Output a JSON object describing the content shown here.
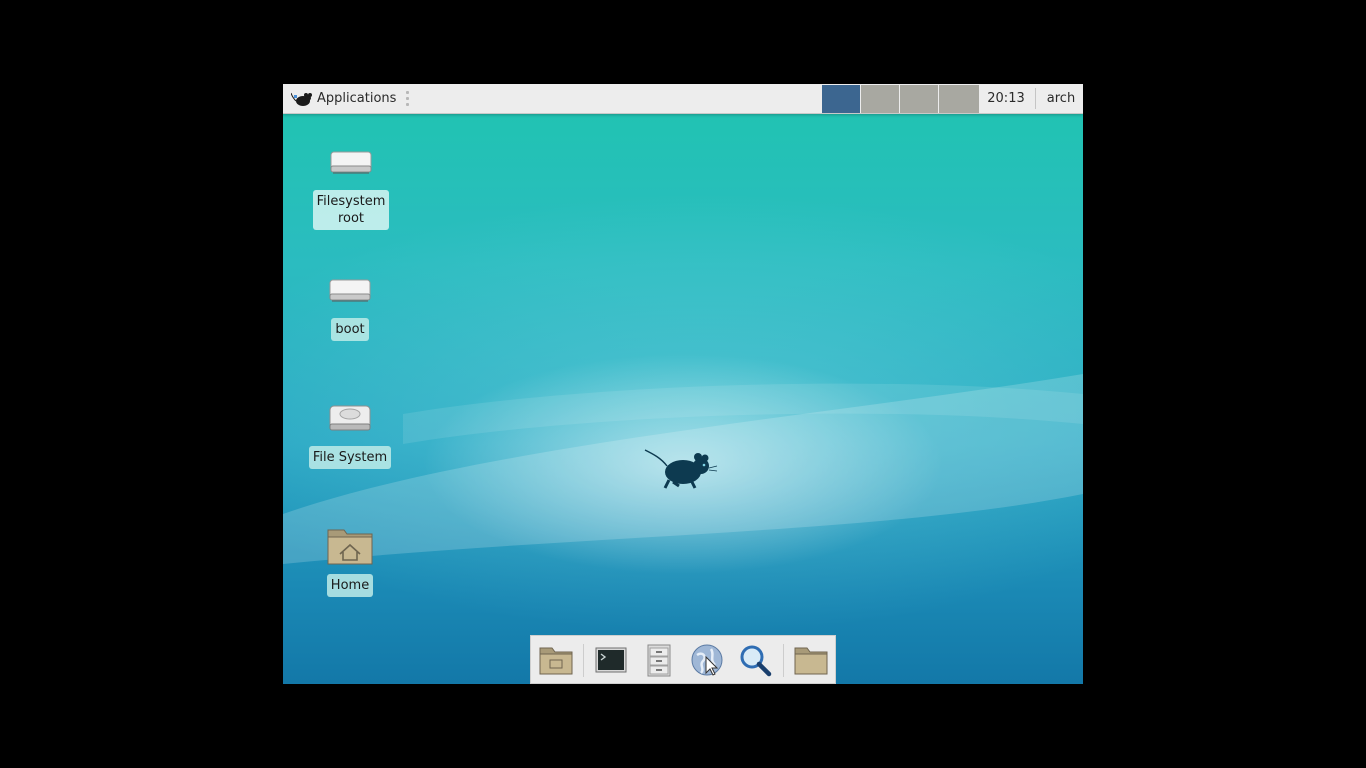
{
  "panel": {
    "menu_label": "Applications",
    "clock": "20:13",
    "user": "arch",
    "workspaces": [
      {
        "index": 1,
        "active": true
      },
      {
        "index": 2,
        "active": false
      },
      {
        "index": 3,
        "active": false
      },
      {
        "index": 4,
        "active": false
      }
    ],
    "colors": {
      "active_workspace": "#3c6690",
      "inactive_workspace": "#a8a8a1"
    }
  },
  "desktop": {
    "icons": [
      {
        "label": "Filesystem\nroot",
        "icon": "drive-icon"
      },
      {
        "label": "boot",
        "icon": "drive-icon"
      },
      {
        "label": "File System",
        "icon": "harddisk-icon"
      },
      {
        "label": "Home",
        "icon": "home-folder-icon"
      }
    ]
  },
  "dock": {
    "items": [
      {
        "icon": "desktop-folder-icon"
      },
      {
        "icon": "terminal-icon"
      },
      {
        "icon": "file-cabinet-icon"
      },
      {
        "icon": "web-browser-icon"
      },
      {
        "icon": "search-icon"
      },
      {
        "icon": "folder-icon"
      }
    ]
  }
}
